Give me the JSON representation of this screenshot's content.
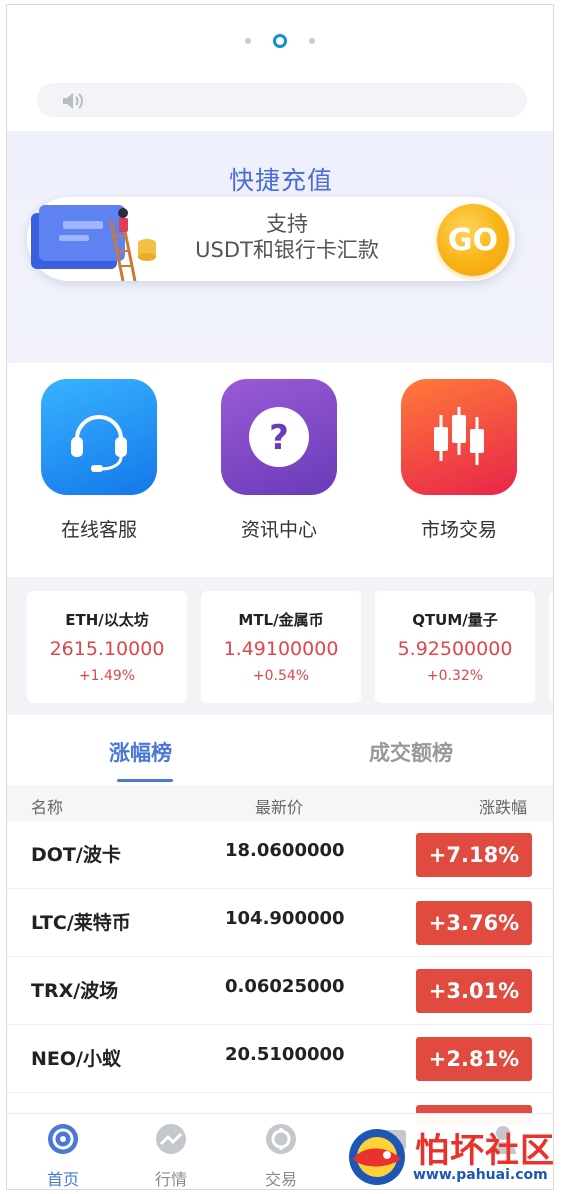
{
  "carousel": {
    "dots": 3,
    "active_index": 1
  },
  "notice": {
    "icon": "speaker-icon",
    "text": ""
  },
  "recharge": {
    "title": "快捷充值",
    "line1": "支持",
    "line2": "USDT和银行卡汇款",
    "go_label": "GO"
  },
  "quick_links": [
    {
      "label": "在线客服",
      "icon": "headset-icon",
      "color": "#1a8ef0"
    },
    {
      "label": "资讯中心",
      "icon": "question-icon",
      "color": "#7b46c4"
    },
    {
      "label": "市场交易",
      "icon": "candlestick-icon",
      "color": "#f2473c"
    }
  ],
  "tickers": [
    {
      "name": "ETH/以太坊",
      "price": "2615.10000",
      "change": "+1.49%"
    },
    {
      "name": "MTL/金属币",
      "price": "1.49100000",
      "change": "+0.54%"
    },
    {
      "name": "QTUM/量子",
      "price": "5.92500000",
      "change": "+0.32%"
    }
  ],
  "ranking": {
    "tabs": [
      "涨幅榜",
      "成交额榜"
    ],
    "active_tab": 0,
    "headers": [
      "名称",
      "最新价",
      "涨跌幅"
    ],
    "rows": [
      {
        "symbol": "DOT/波卡",
        "price": "18.0600000",
        "change": "+7.18%"
      },
      {
        "symbol": "LTC/莱特币",
        "price": "104.900000",
        "change": "+3.76%"
      },
      {
        "symbol": "TRX/波场",
        "price": "0.06025000",
        "change": "+3.01%"
      },
      {
        "symbol": "NEO/小蚁",
        "price": "20.5100000",
        "change": "+2.81%"
      }
    ]
  },
  "bottom_nav": [
    {
      "label": "首页",
      "icon": "home-icon",
      "active": true
    },
    {
      "label": "行情",
      "icon": "market-trend-icon",
      "active": false
    },
    {
      "label": "交易",
      "icon": "trade-icon",
      "active": false
    },
    {
      "label": "",
      "icon": "assets-icon",
      "active": false
    },
    {
      "label": "",
      "icon": "profile-icon",
      "active": false
    }
  ],
  "watermark": {
    "text": "怕坏社区",
    "url": "www.pahuai.com"
  },
  "colors": {
    "accent": "#4a78d6",
    "up": "#e14a3e",
    "go": "#f8b315"
  }
}
